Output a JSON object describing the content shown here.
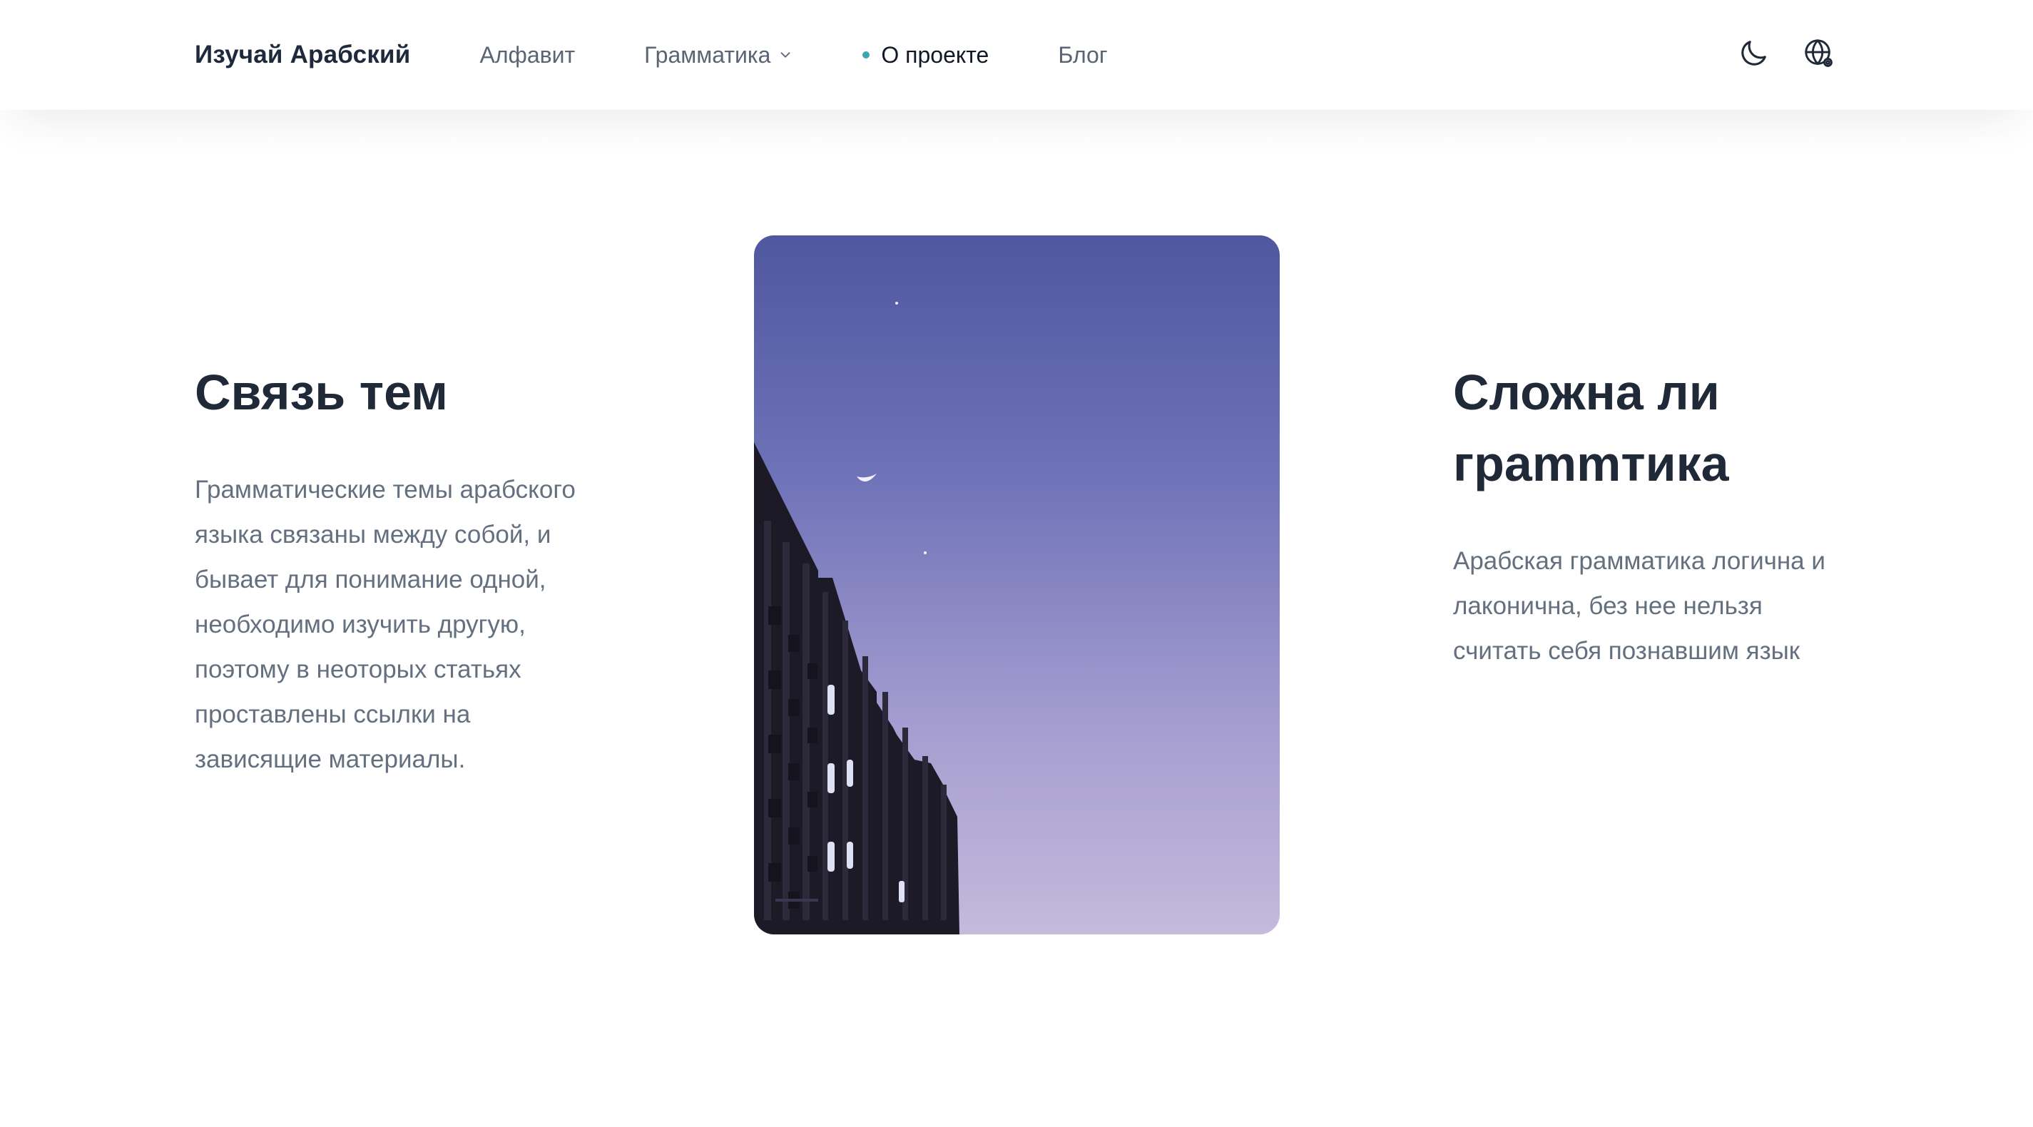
{
  "header": {
    "brand": "Изучай Арабский",
    "nav": {
      "alphabet": "Алфавит",
      "grammar": "Грамматика",
      "about": "О проекте",
      "blog": "Блог"
    },
    "icons": [
      "moon-icon",
      "globe-icon"
    ]
  },
  "left": {
    "title": "Связь тем",
    "text": "Грамматические темы арабского языка связаны между собой, и бывает для понимание одной, необходимо изучить другую, поэтому в неоторых статьях проставлены ссылки на зависящие материалы."
  },
  "right": {
    "title": "Сложна ли грammтика",
    "text": "Арабская грамматика логична и лаконична, без нее нельзя считать себя познавшим язык"
  },
  "colors": {
    "accent": "#3aa7b0",
    "sky_top": "#4f579f",
    "sky_bottom": "#c2b8dc"
  }
}
